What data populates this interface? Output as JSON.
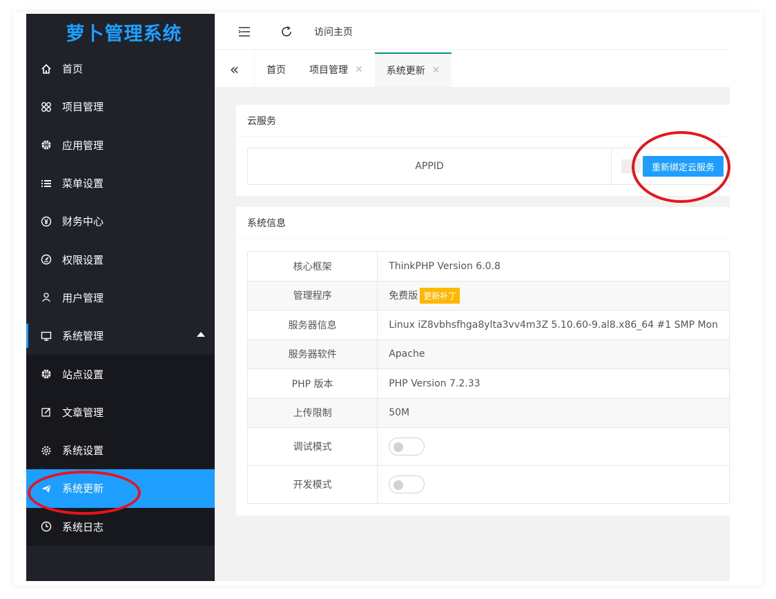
{
  "app": {
    "title": "萝卜管理系统",
    "brand_color": "#1e9fff",
    "sidebar_bg": "#20222a"
  },
  "sidebar": {
    "items": [
      {
        "label": "首页",
        "icon": "home-icon"
      },
      {
        "label": "项目管理",
        "icon": "apps-icon"
      },
      {
        "label": "应用管理",
        "icon": "globe-icon"
      },
      {
        "label": "菜单设置",
        "icon": "list-icon"
      },
      {
        "label": "财务中心",
        "icon": "yen-icon"
      },
      {
        "label": "权限设置",
        "icon": "gauge-icon"
      },
      {
        "label": "用户管理",
        "icon": "user-icon"
      },
      {
        "label": "系统管理",
        "icon": "monitor-icon",
        "expanded": true
      }
    ],
    "sub_items": [
      {
        "label": "站点设置",
        "icon": "globe-icon"
      },
      {
        "label": "文章管理",
        "icon": "edit-icon"
      },
      {
        "label": "系统设置",
        "icon": "gear-icon"
      },
      {
        "label": "系统更新",
        "icon": "send-icon",
        "active": true
      },
      {
        "label": "系统日志",
        "icon": "clock-icon"
      }
    ]
  },
  "topbar": {
    "home_link": "访问主页"
  },
  "tabs": [
    {
      "label": "首页",
      "closable": false
    },
    {
      "label": "项目管理",
      "closable": true
    },
    {
      "label": "系统更新",
      "closable": true,
      "active": true
    }
  ],
  "cloud": {
    "title": "云服务",
    "appid_label": "APPID",
    "rebind_button": "重新绑定云服务"
  },
  "sysinfo": {
    "title": "系统信息",
    "rows": [
      {
        "key": "核心框架",
        "value": "ThinkPHP Version 6.0.8"
      },
      {
        "key": "管理程序",
        "value": "免费版",
        "badge": "更新补丁"
      },
      {
        "key": "服务器信息",
        "value": "Linux iZ8vbhsfhga8ylta3vv4m3Z 5.10.60-9.al8.x86_64 #1 SMP Mon"
      },
      {
        "key": "服务器软件",
        "value": "Apache"
      },
      {
        "key": "PHP 版本",
        "value": "PHP Version 7.2.33"
      },
      {
        "key": "上传限制",
        "value": "50M"
      },
      {
        "key": "调试模式",
        "toggle": false
      },
      {
        "key": "开发模式",
        "toggle": false
      }
    ]
  }
}
